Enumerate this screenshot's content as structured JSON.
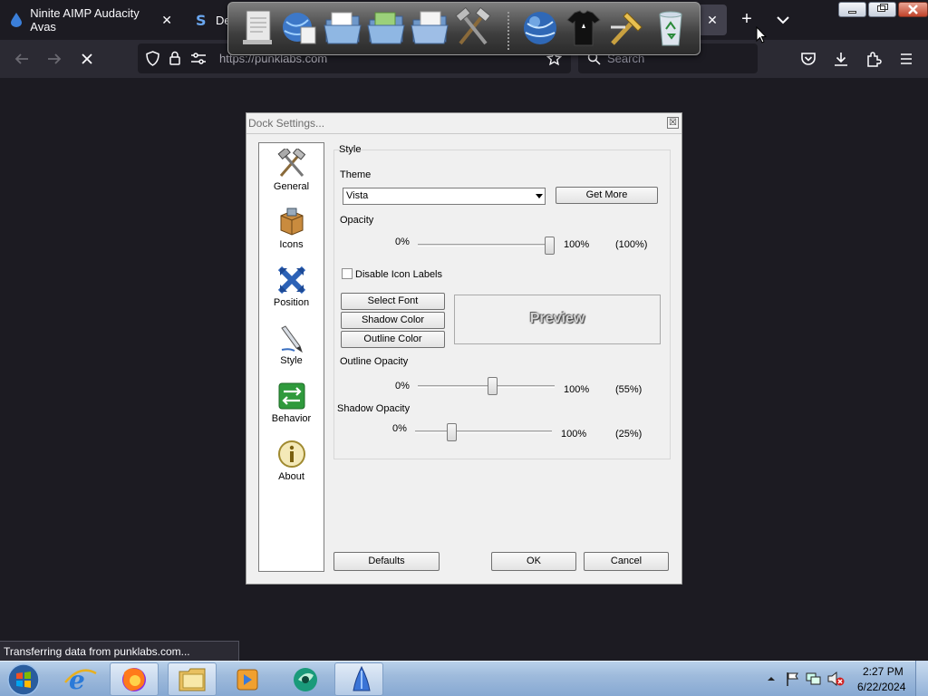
{
  "browser": {
    "tabs": [
      {
        "title": "Ninite AIMP Audacity Avas",
        "close": "✕"
      },
      {
        "title": "Des"
      }
    ],
    "active_tab_close": "✕",
    "new_tab": "+",
    "url": "https://punklabs.com",
    "search_placeholder": "Search",
    "status": "Transferring data from punklabs.com..."
  },
  "dialog": {
    "title": "Dock Settings...",
    "close_glyph": "☒",
    "categories": [
      {
        "label": "General",
        "icon": "tools-icon"
      },
      {
        "label": "Icons",
        "icon": "box-icon"
      },
      {
        "label": "Position",
        "icon": "arrows-icon"
      },
      {
        "label": "Style",
        "icon": "pen-icon"
      },
      {
        "label": "Behavior",
        "icon": "behavior-icon"
      },
      {
        "label": "About",
        "icon": "info-icon"
      }
    ],
    "style": {
      "group_label": "Style",
      "theme_label": "Theme",
      "theme_value": "Vista",
      "get_more": "Get More",
      "opacity_label": "Opacity",
      "opacity_min": "0%",
      "opacity_max": "100%",
      "opacity_value": "(100%)",
      "opacity_level": 1.0,
      "disable_icon_labels": "Disable Icon Labels",
      "disable_icon_labels_checked": false,
      "select_font": "Select Font",
      "shadow_color": "Shadow Color",
      "outline_color": "Outline Color",
      "preview": "Preview",
      "outline_opacity_label": "Outline Opacity",
      "outline_min": "0%",
      "outline_max": "100%",
      "outline_value": "(55%)",
      "outline_level": 0.55,
      "shadow_opacity_label": "Shadow Opacity",
      "shadow_min": "0%",
      "shadow_max": "100%",
      "shadow_value": "(25%)",
      "shadow_level": 0.25
    },
    "buttons": {
      "defaults": "Defaults",
      "ok": "OK",
      "cancel": "Cancel"
    }
  },
  "dock_icons": [
    "notepad-icon",
    "globe-docs-icon",
    "folder-icon",
    "folder-green-icon",
    "folder-docs-icon",
    "tools-icon",
    "globe-icon",
    "tshirt-icon",
    "hammer-icon",
    "recycle-bin-icon"
  ],
  "taskbar": {
    "apps": [
      "ie-icon",
      "firefox-icon",
      "explorer-icon",
      "media-player-icon",
      "greenapp-icon",
      "rocket-dock-icon"
    ],
    "time": "2:27 PM",
    "date": "6/22/2024"
  }
}
